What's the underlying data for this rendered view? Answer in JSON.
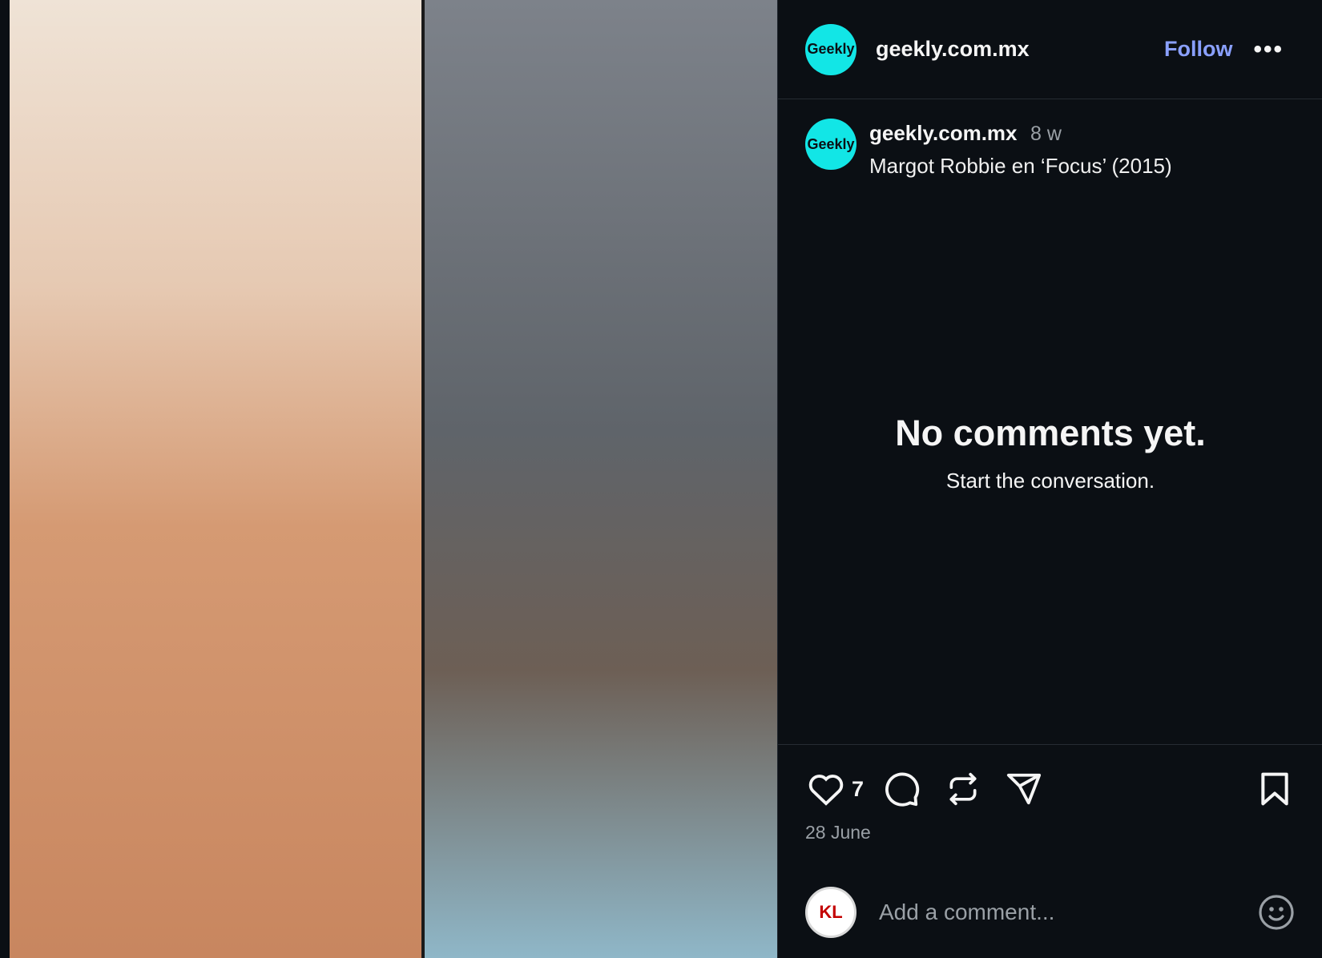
{
  "header": {
    "avatar_text": "Geekly",
    "username": "geekly.com.mx",
    "follow_label": "Follow",
    "more_label": "•••"
  },
  "caption": {
    "avatar_text": "Geekly",
    "username": "geekly.com.mx",
    "time": "8 w",
    "text": "Margot Robbie en ‘Focus’ (2015)"
  },
  "comments": {
    "empty_title": "No comments yet.",
    "empty_subtitle": "Start the conversation."
  },
  "actions": {
    "like_count": "7",
    "date": "28 June",
    "icons": [
      "heart-icon",
      "comment-icon",
      "repost-icon",
      "share-icon",
      "bookmark-icon"
    ]
  },
  "comment_bar": {
    "avatar_text": "KL",
    "placeholder": "Add a comment..."
  },
  "colors": {
    "background": "#0b0f14",
    "accent": "#8aa0ff",
    "brand_avatar": "#12e6e6"
  }
}
